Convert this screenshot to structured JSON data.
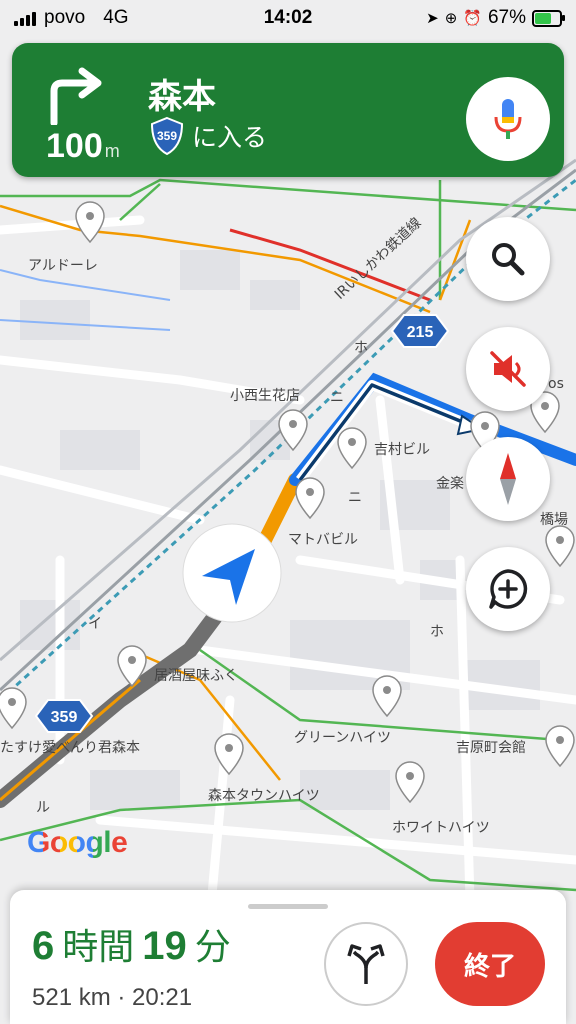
{
  "status_bar": {
    "carrier": "povo",
    "network": "4G",
    "time": "14:02",
    "battery": "67%"
  },
  "banner": {
    "distance_value": "100",
    "distance_unit": "m",
    "street": "森本",
    "route_number": "359",
    "action": "に入る"
  },
  "map": {
    "labels": {
      "ardore": "アルドーレ",
      "railway": "IRいしかわ鉄道線",
      "konishi": "小西生花店",
      "yoshimura": "吉村ビル",
      "kin": "金楽",
      "hashiba": "橋場",
      "matoba": "マトバビル",
      "ajifuku": "居酒屋味ふく",
      "kunmorimoto": "たすけ愛べんり君森本",
      "green": "グリーンハイツ",
      "yoshihara": "吉原町会館",
      "morimoto_town": "森本タウンハイツ",
      "white": "ホワイトハイツ",
      "ho1": "ホ",
      "ho2": "ホ",
      "ni1": "ニ",
      "ni2": "ニ",
      "i": "イ",
      "ru": "ル",
      "os": "os",
      "shield_215": "215",
      "shield_359": "359"
    },
    "logo": "Google"
  },
  "controls": {
    "search_icon": "magnifier-icon",
    "mute_icon": "speaker-muted-icon",
    "compass_icon": "compass-icon",
    "report_icon": "add-report-icon"
  },
  "trip": {
    "hours": "6",
    "hours_label": "時間",
    "minutes": "19",
    "minutes_label": "分",
    "distance": "521 km",
    "arrival": "20:21",
    "exit_label": "終了"
  },
  "colors": {
    "banner_green": "#1e7e34",
    "exit_red": "#e23d32",
    "route_blue": "#1a73e8",
    "traffic_orange": "#f29900"
  }
}
